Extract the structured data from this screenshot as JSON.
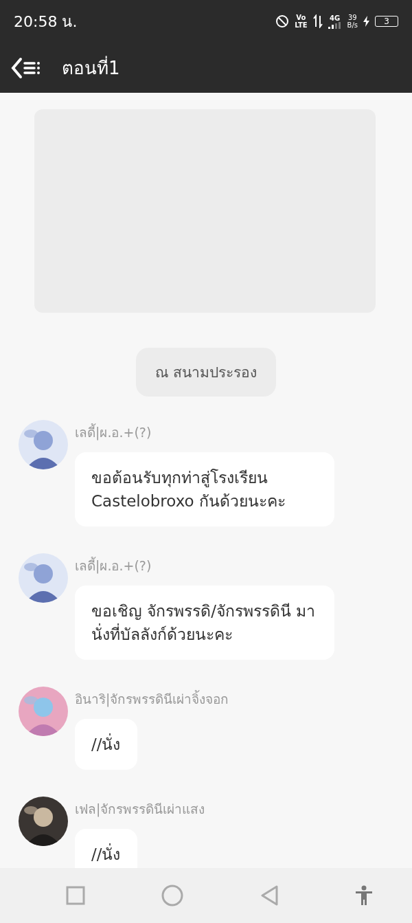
{
  "status_bar": {
    "time": "20:58 น.",
    "volte_top": "Vo",
    "volte_bottom": "LTE",
    "network": "4G",
    "speed_value": "39",
    "speed_unit": "B/s",
    "battery": "3"
  },
  "header": {
    "title": "ตอนที่1"
  },
  "scene": {
    "label": "ณ สนามประรอง"
  },
  "messages": [
    {
      "author": "เลดี้|ผ.อ.+(?)",
      "text": "ขอต้อนรับทุกท่าสู่โรงเรียน Castelobroxo กันด้วยนะคะ"
    },
    {
      "author": "เลดี้|ผ.อ.+(?)",
      "text": "ขอเชิญ จักรพรรดิ/จักรพรรดินี มานั่งที่บัลลังก์ด้วยนะคะ"
    },
    {
      "author": "อินาริ|จักรพรรดินีเผ่าจิ้งจอก",
      "text": "//นั่ง"
    },
    {
      "author": "เฟล|จักรพรรดินีเผ่าแสง",
      "text": "//นั่ง"
    }
  ]
}
